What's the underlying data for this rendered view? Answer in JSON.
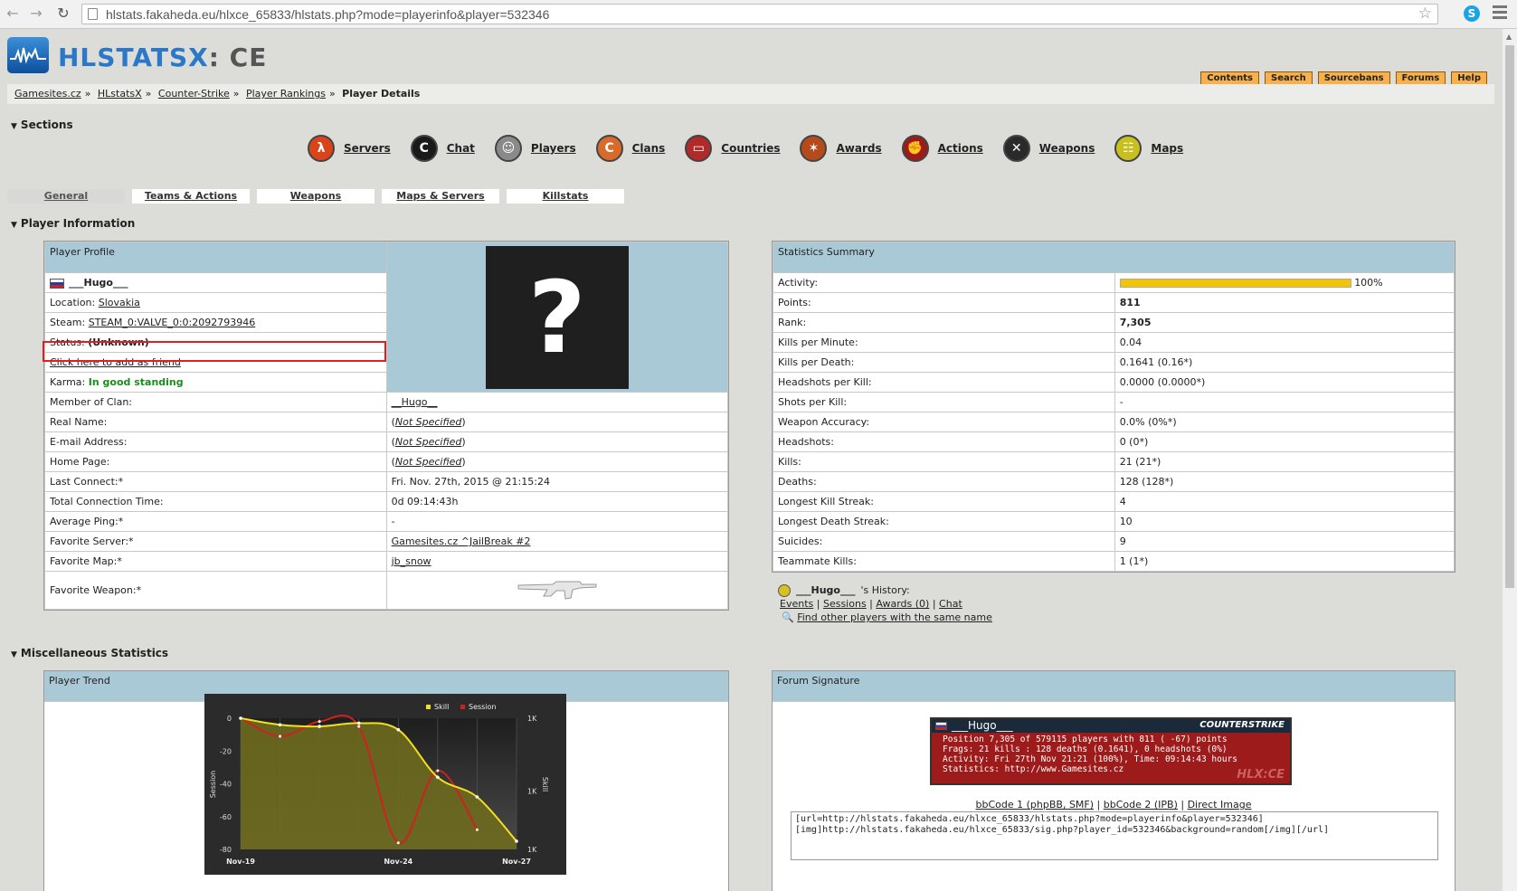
{
  "browser": {
    "url": "hlstats.fakaheda.eu/hlxce_65833/hlstats.php?mode=playerinfo&player=532346"
  },
  "header": {
    "logo_text": "HLSTATSX",
    "logo_suffix": ": CE",
    "buttons": [
      "Contents",
      "Search",
      "Sourcebans",
      "Forums",
      "Help"
    ]
  },
  "breadcrumb": {
    "items": [
      "Gamesites.cz",
      "HLstatsX",
      "Counter-Strike",
      "Player Rankings"
    ],
    "current": "Player Details",
    "sep": "»"
  },
  "sections": {
    "title": "Sections",
    "items": [
      {
        "label": "Servers",
        "icon": "servers-icon",
        "color": "#d9441a",
        "glyph": "λ"
      },
      {
        "label": "Chat",
        "icon": "chat-icon",
        "color": "#1a1a1a",
        "glyph": "C"
      },
      {
        "label": "Players",
        "icon": "players-icon",
        "color": "#8a8a8a",
        "glyph": "☺"
      },
      {
        "label": "Clans",
        "icon": "clans-icon",
        "color": "#d86a2a",
        "glyph": "C"
      },
      {
        "label": "Countries",
        "icon": "countries-icon",
        "color": "#b02a2a",
        "glyph": "▭"
      },
      {
        "label": "Awards",
        "icon": "awards-icon",
        "color": "#b54a1a",
        "glyph": "✶"
      },
      {
        "label": "Actions",
        "icon": "actions-icon",
        "color": "#a01a1a",
        "glyph": "✊"
      },
      {
        "label": "Weapons",
        "icon": "weapons-icon",
        "color": "#2a2a2a",
        "glyph": "✕"
      },
      {
        "label": "Maps",
        "icon": "maps-icon",
        "color": "#c8c020",
        "glyph": "☷"
      }
    ]
  },
  "tabs": [
    "General",
    "Teams & Actions",
    "Weapons",
    "Maps & Servers",
    "Killstats"
  ],
  "player_info": {
    "title": "Player Information",
    "profile_header": "Player Profile",
    "name": "___Hugo___",
    "location_label": "Location:",
    "location": "Slovakia",
    "steam_label": "Steam:",
    "steam": "STEAM_0:VALVE_0:0:2092793946",
    "status_label": "Status:",
    "status": "(Unknown)",
    "friend_link": "Click here to add as friend",
    "karma_label": "Karma:",
    "karma": "In good standing",
    "rows": [
      {
        "label": "Member of Clan:",
        "value": "__Hugo__",
        "style": "link"
      },
      {
        "label": "Real Name:",
        "value": "Not Specified",
        "style": "paren"
      },
      {
        "label": "E-mail Address:",
        "value": "Not Specified",
        "style": "paren"
      },
      {
        "label": "Home Page:",
        "value": "Not Specified",
        "style": "paren"
      },
      {
        "label": "Last Connect:*",
        "value": "Fri. Nov. 27th, 2015 @ 21:15:24",
        "style": "plain"
      },
      {
        "label": "Total Connection Time:",
        "value": "0d 09:14:43h",
        "style": "plain"
      },
      {
        "label": "Average Ping:*",
        "value": "-",
        "style": "plain"
      },
      {
        "label": "Favorite Server:*",
        "value": "Gamesites.cz ^JailBreak #2",
        "style": "link"
      },
      {
        "label": "Favorite Map:*",
        "value": "jb_snow",
        "style": "link"
      }
    ],
    "weapon_label": "Favorite Weapon:*",
    "avatar_glyph": "?"
  },
  "stats_summary": {
    "header": "Statistics Summary",
    "activity_label": "Activity:",
    "activity_pct": "100%",
    "activity_fraction": 1.0,
    "rows": [
      {
        "label": "Points:",
        "value": "811",
        "bold": true
      },
      {
        "label": "Rank:",
        "value": "7,305",
        "bold": true
      },
      {
        "label": "Kills per Minute:",
        "value": "0.04"
      },
      {
        "label": "Kills per Death:",
        "value": "0.1641 (0.16*)"
      },
      {
        "label": "Headshots per Kill:",
        "value": "0.0000 (0.0000*)"
      },
      {
        "label": "Shots per Kill:",
        "value": "-"
      },
      {
        "label": "Weapon Accuracy:",
        "value": "0.0% (0%*)"
      },
      {
        "label": "Headshots:",
        "value": "0 (0*)"
      },
      {
        "label": "Kills:",
        "value": "21 (21*)"
      },
      {
        "label": "Deaths:",
        "value": "128 (128*)"
      },
      {
        "label": "Longest Kill Streak:",
        "value": "4"
      },
      {
        "label": "Longest Death Streak:",
        "value": "10"
      },
      {
        "label": "Suicides:",
        "value": "9"
      },
      {
        "label": "Teammate Kills:",
        "value": "1 (1*)"
      }
    ]
  },
  "history": {
    "name": "___Hugo___",
    "suffix": "'s History:",
    "links": [
      "Events",
      "Sessions",
      "Awards (0)",
      "Chat"
    ],
    "sep": "|",
    "find_link": "Find other players with the same name"
  },
  "misc": {
    "title": "Miscellaneous Statistics",
    "trend_header": "Player Trend",
    "signature_header": "Forum Signature"
  },
  "chart_data": {
    "type": "line",
    "x": [
      "Nov-19",
      "",
      "",
      "",
      "Nov-24",
      "",
      "",
      "Nov-27"
    ],
    "xtick_labels": [
      "Nov-19",
      "Nov-24",
      "Nov-27"
    ],
    "ylabel_left": "Session",
    "ylabel_right": "Skill",
    "yticks_left": [
      "0",
      "-20",
      "-40",
      "-60",
      "-80"
    ],
    "yticks_right": [
      "1K",
      "1K",
      "1K"
    ],
    "ylim_left": [
      -80,
      0
    ],
    "series": [
      {
        "name": "Skill",
        "color": "#f0e020",
        "values": [
          0,
          -4,
          -5,
          -3,
          -7,
          -36,
          -48,
          -75
        ]
      },
      {
        "name": "Session",
        "color": "#d02020",
        "values": [
          0,
          -11,
          -2,
          -5,
          -76,
          -32,
          -68
        ]
      }
    ],
    "legend": "top-right"
  },
  "signature": {
    "name": "___Hugo___",
    "game": "COUNTERSTRIKE",
    "line1": "Position 7,305 of 579115 players with 811 ( -67) points",
    "line2": "Frags: 21 kills : 128 deaths (0.1641), 0 headshots (0%)",
    "line3": "Activity: Fri 27th Nov 21:21 (100%), Time: 09:14:43 hours",
    "line4": "Statistics: http://www.Gamesites.cz",
    "watermark": "HLX:CE",
    "links": [
      "bbCode 1 (phpBB, SMF)",
      "bbCode 2 (IPB)",
      "Direct Image"
    ],
    "code_line1": "[url=http://hlstats.fakaheda.eu/hlxce_65833/hlstats.php?mode=playerinfo&player=532346]",
    "code_line2": "[img]http://hlstats.fakaheda.eu/hlxce_65833/sig.php?player_id=532346&background=random[/img][/url]"
  }
}
